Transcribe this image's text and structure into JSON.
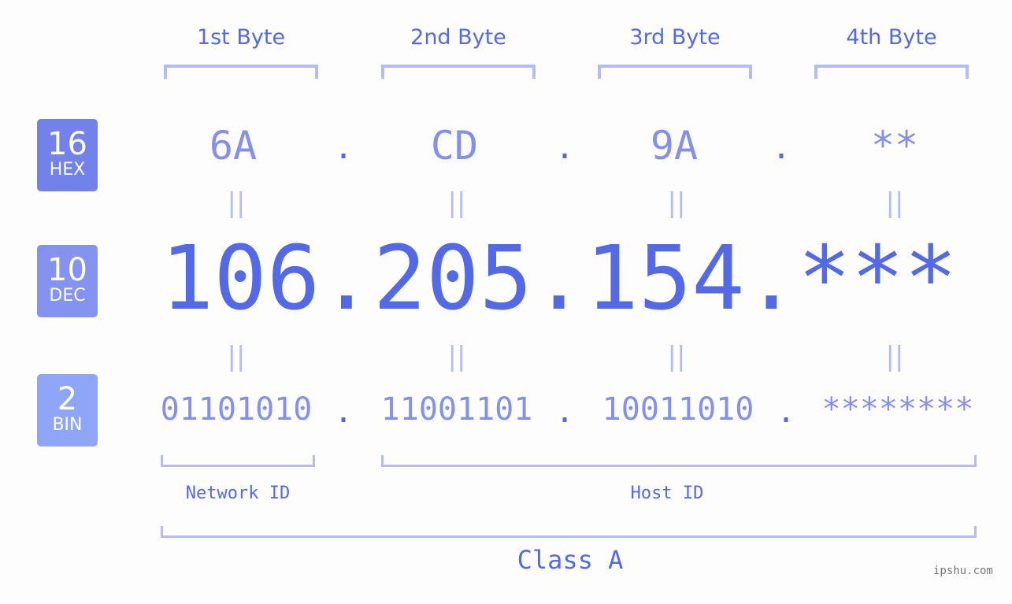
{
  "bytes": [
    {
      "label": "1st Byte",
      "hex": "6A",
      "dec": "106",
      "bin": "01101010"
    },
    {
      "label": "2nd Byte",
      "hex": "CD",
      "dec": "205",
      "bin": "11001101"
    },
    {
      "label": "3rd Byte",
      "hex": "9A",
      "dec": "154",
      "bin": "10011010"
    },
    {
      "label": "4th Byte",
      "hex": "**",
      "dec": "***",
      "bin": "********"
    }
  ],
  "separator": ".",
  "equals": "||",
  "badges": {
    "hex": {
      "num": "16",
      "label": "HEX",
      "color": "#7381ea"
    },
    "dec": {
      "num": "10",
      "label": "DEC",
      "color": "#8492f0"
    },
    "bin": {
      "num": "2",
      "label": "BIN",
      "color": "#8fa6f8"
    }
  },
  "dec_full": "106.205.154.***",
  "network_id": "Network ID",
  "host_id": "Host ID",
  "class": "Class A",
  "brand": "ipshu.com",
  "colors": {
    "accent": "#5469e6",
    "light": "#8490ee",
    "bracket": "#b3bcf5"
  }
}
